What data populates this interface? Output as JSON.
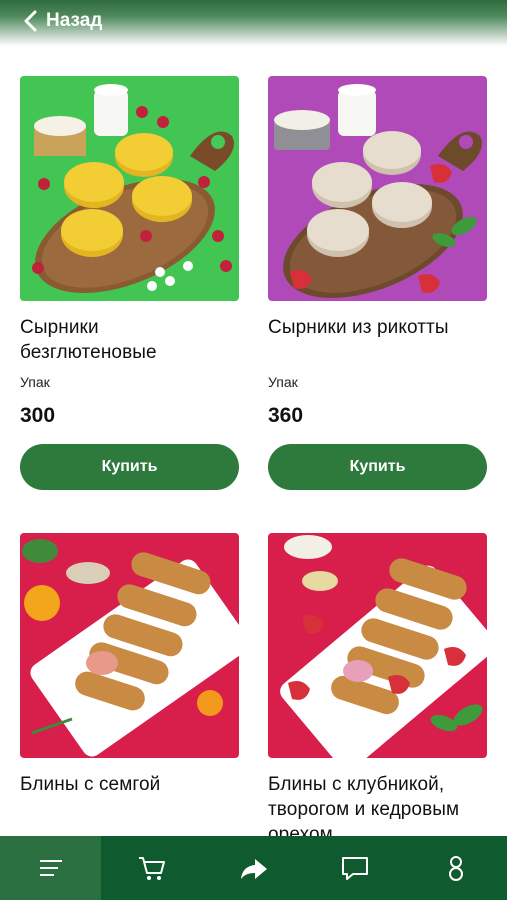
{
  "header": {
    "back_label": "Назад"
  },
  "products": [
    {
      "title": "Сырники безглютеновые",
      "unit": "Упак",
      "price": "300",
      "buy_label": "Купить"
    },
    {
      "title": "Сырники из рикотты",
      "unit": "Упак",
      "price": "360",
      "buy_label": "Купить"
    },
    {
      "title": "Блины с семгой"
    },
    {
      "title": "Блины с клубникой, творогом и кедровым орехом"
    }
  ],
  "nav": {
    "items": [
      "menu-icon",
      "cart-icon",
      "share-icon",
      "chat-icon",
      "profile-icon"
    ],
    "active": "menu-icon"
  },
  "colors": {
    "accent": "#2e7a3c",
    "nav_bg": "#0f5a2e"
  }
}
